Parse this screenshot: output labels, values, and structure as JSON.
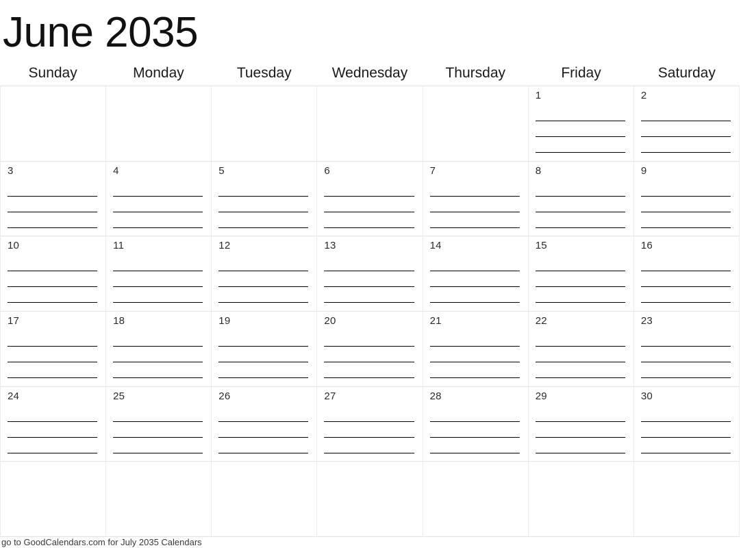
{
  "title": "June 2035",
  "month": "June",
  "year": "2035",
  "weekdays": [
    "Sunday",
    "Monday",
    "Tuesday",
    "Wednesday",
    "Thursday",
    "Friday",
    "Saturday"
  ],
  "grid": {
    "rows": 6,
    "columns": 7,
    "lines_per_day": 4,
    "cells": [
      {
        "day": "",
        "empty": true
      },
      {
        "day": "",
        "empty": true
      },
      {
        "day": "",
        "empty": true
      },
      {
        "day": "",
        "empty": true
      },
      {
        "day": "",
        "empty": true
      },
      {
        "day": "1",
        "empty": false
      },
      {
        "day": "2",
        "empty": false
      },
      {
        "day": "3",
        "empty": false
      },
      {
        "day": "4",
        "empty": false
      },
      {
        "day": "5",
        "empty": false
      },
      {
        "day": "6",
        "empty": false
      },
      {
        "day": "7",
        "empty": false
      },
      {
        "day": "8",
        "empty": false
      },
      {
        "day": "9",
        "empty": false
      },
      {
        "day": "10",
        "empty": false
      },
      {
        "day": "11",
        "empty": false
      },
      {
        "day": "12",
        "empty": false
      },
      {
        "day": "13",
        "empty": false
      },
      {
        "day": "14",
        "empty": false
      },
      {
        "day": "15",
        "empty": false
      },
      {
        "day": "16",
        "empty": false
      },
      {
        "day": "17",
        "empty": false
      },
      {
        "day": "18",
        "empty": false
      },
      {
        "day": "19",
        "empty": false
      },
      {
        "day": "20",
        "empty": false
      },
      {
        "day": "21",
        "empty": false
      },
      {
        "day": "22",
        "empty": false
      },
      {
        "day": "23",
        "empty": false
      },
      {
        "day": "24",
        "empty": false
      },
      {
        "day": "25",
        "empty": false
      },
      {
        "day": "26",
        "empty": false
      },
      {
        "day": "27",
        "empty": false
      },
      {
        "day": "28",
        "empty": false
      },
      {
        "day": "29",
        "empty": false
      },
      {
        "day": "30",
        "empty": false
      },
      {
        "day": "",
        "empty": true
      },
      {
        "day": "",
        "empty": true
      },
      {
        "day": "",
        "empty": true
      },
      {
        "day": "",
        "empty": true
      },
      {
        "day": "",
        "empty": true
      },
      {
        "day": "",
        "empty": true
      },
      {
        "day": "",
        "empty": true
      }
    ]
  },
  "footer": {
    "text": "go to GoodCalendars.com for July 2035 Calendars"
  },
  "colors": {
    "page_background": "#ffffff",
    "title_text": "#111111",
    "weekday_text": "#1a1a1a",
    "daynum_text": "#2b2b2b",
    "grid_border": "#ededed",
    "grid_border_row": "#e3e3e3",
    "writing_line": "#000000",
    "footer_text": "#3a3a3a"
  }
}
